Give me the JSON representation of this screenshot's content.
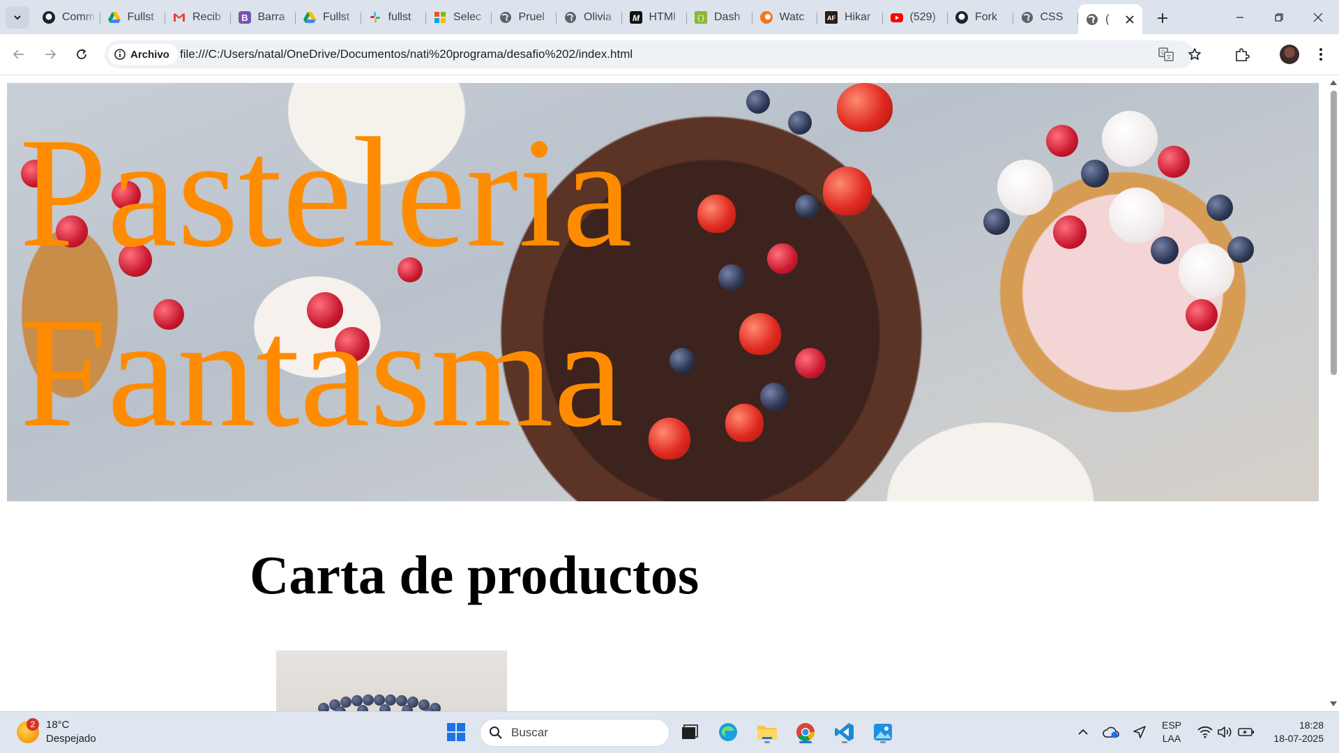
{
  "browser": {
    "tabs": [
      {
        "title": "Comm",
        "icon": "github-icon"
      },
      {
        "title": "Fullst",
        "icon": "google-drive-icon"
      },
      {
        "title": "Recib",
        "icon": "gmail-icon"
      },
      {
        "title": "Barra",
        "icon": "bootstrap-icon"
      },
      {
        "title": "Fullst",
        "icon": "google-drive-icon"
      },
      {
        "title": "fullst",
        "icon": "slack-icon"
      },
      {
        "title": "Selec",
        "icon": "microsoft-icon"
      },
      {
        "title": "Pruel",
        "icon": "globe-icon"
      },
      {
        "title": "Olivia",
        "icon": "globe-icon"
      },
      {
        "title": "HTMl",
        "icon": "html-icon"
      },
      {
        "title": "Dash",
        "icon": "json-icon"
      },
      {
        "title": "Watc",
        "icon": "crunchyroll-icon"
      },
      {
        "title": "Hikar",
        "icon": "af-icon"
      },
      {
        "title": "(529)",
        "icon": "youtube-icon"
      },
      {
        "title": "Fork",
        "icon": "github-icon"
      },
      {
        "title": "CSS",
        "icon": "globe-icon"
      },
      {
        "title": "(",
        "icon": "globe-icon",
        "active": true
      }
    ],
    "address": {
      "chip_label": "Archivo",
      "url": "file:///C:/Users/natal/OneDrive/Documentos/nati%20programa/desafio%202/index.html"
    }
  },
  "page": {
    "hero_title_line1": "Pasteleria",
    "hero_title_line2": "Fantasma",
    "menu_title": "Carta de productos",
    "hero_title_color": "#ff8c00"
  },
  "taskbar": {
    "weather_temp": "18°C",
    "weather_desc": "Despejado",
    "weather_badge": "2",
    "search_placeholder": "Buscar",
    "lang_line1": "ESP",
    "lang_line2": "LAA",
    "time": "18:28",
    "date": "18-07-2025"
  }
}
